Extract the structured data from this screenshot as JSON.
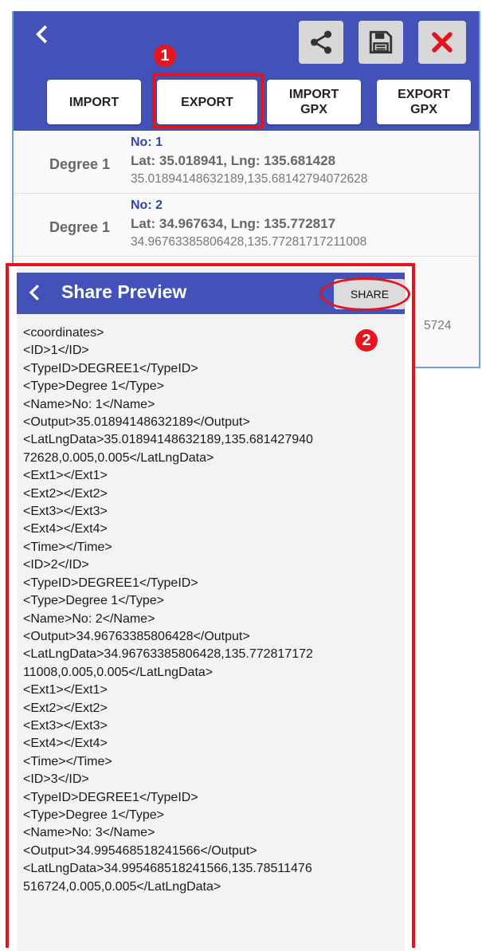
{
  "toolbar": {
    "buttons": [
      {
        "label": "IMPORT"
      },
      {
        "label": "EXPORT"
      },
      {
        "label": "IMPORT\nGPX"
      },
      {
        "label": "EXPORT\nGPX"
      }
    ]
  },
  "colors": {
    "appbar": "#4352b8",
    "highlight": "#e0151f",
    "link_blue": "#2f47a8"
  },
  "icons": {
    "back": "chevron-left-icon",
    "share": "share-icon",
    "save": "floppy-disk-icon",
    "close": "close-x-icon"
  },
  "annotations": {
    "step1": "1",
    "step2": "2"
  },
  "list": {
    "rows": [
      {
        "type": "Degree 1",
        "no": "No: 1",
        "latlng": "Lat: 35.018941, Lng: 135.681428",
        "raw": "35.01894148632189,135.68142794072628"
      },
      {
        "type": "Degree 1",
        "no": "No: 2",
        "latlng": "Lat: 34.967634, Lng: 135.772817",
        "raw": "34.96763385806428,135.77281717211008"
      }
    ],
    "peek_raw_tail": "5724"
  },
  "preview": {
    "title": "Share Preview",
    "share_label": "SHARE",
    "lines": [
      "<coordinates>",
      "<ID>1</ID>",
      "<TypeID>DEGREE1</TypeID>",
      "<Type>Degree 1</Type>",
      "<Name>No: 1</Name>",
      "<Output>35.01894148632189</Output>",
      "<LatLngData>35.01894148632189,135.681427940",
      "72628,0.005,0.005</LatLngData>",
      "<Ext1></Ext1>",
      "<Ext2></Ext2>",
      "<Ext3></Ext3>",
      "<Ext4></Ext4>",
      "<Time></Time>",
      "<ID>2</ID>",
      "<TypeID>DEGREE1</TypeID>",
      "<Type>Degree 1</Type>",
      "<Name>No: 2</Name>",
      "<Output>34.96763385806428</Output>",
      "<LatLngData>34.96763385806428,135.772817172",
      "11008,0.005,0.005</LatLngData>",
      "<Ext1></Ext1>",
      "<Ext2></Ext2>",
      "<Ext3></Ext3>",
      "<Ext4></Ext4>",
      "<Time></Time>",
      "<ID>3</ID>",
      "<TypeID>DEGREE1</TypeID>",
      "<Type>Degree 1</Type>",
      "<Name>No: 3</Name>",
      "<Output>34.995468518241566</Output>",
      "<LatLngData>34.995468518241566,135.78511476",
      "516724,0.005,0.005</LatLngData>"
    ]
  }
}
